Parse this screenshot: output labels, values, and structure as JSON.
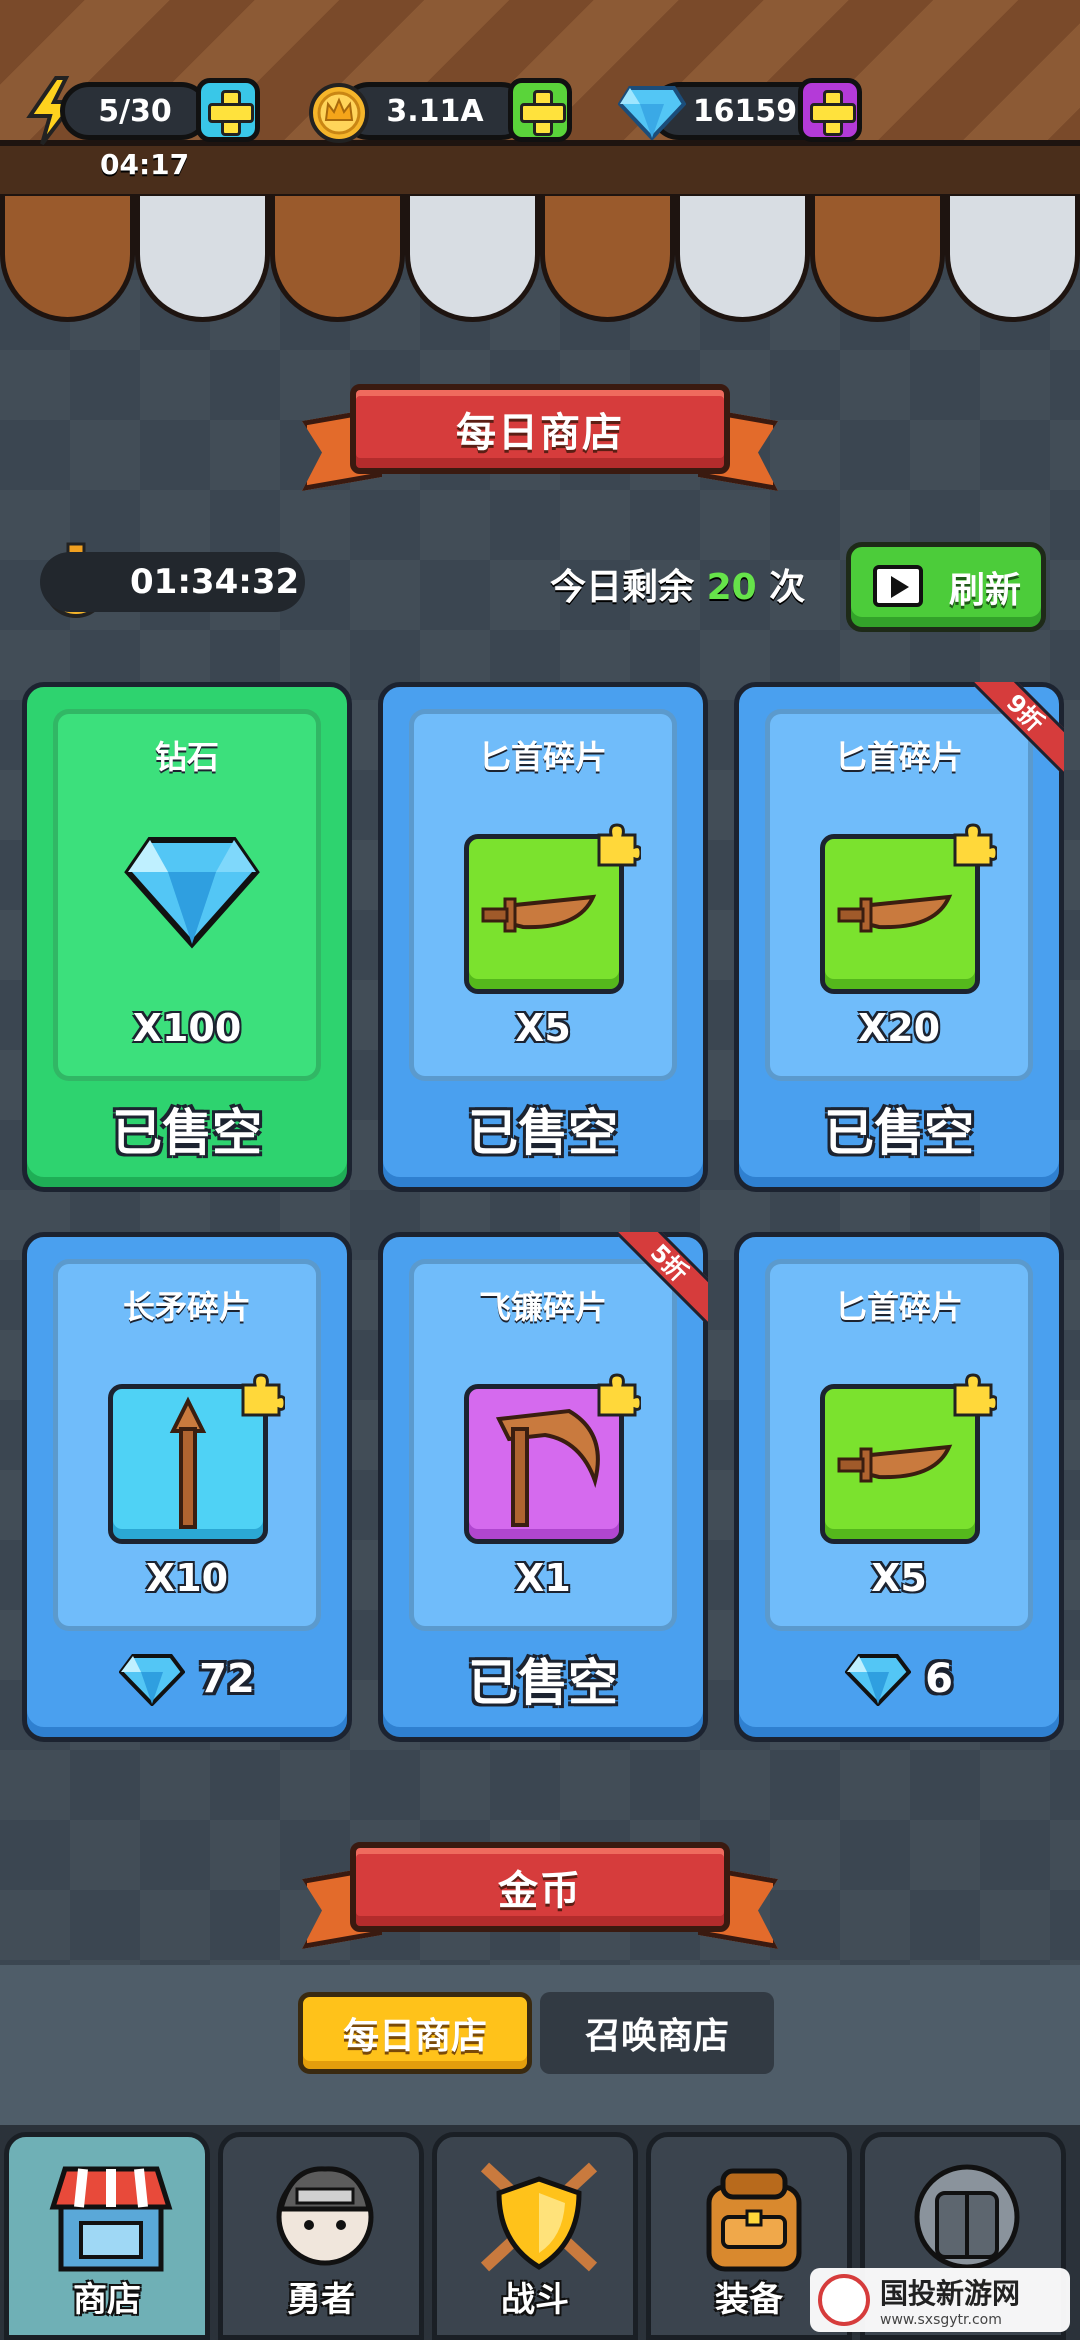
{
  "resources": {
    "energy": {
      "value": "5/30",
      "timer": "04:17",
      "icon": "lightning-icon"
    },
    "gold": {
      "value": "3.11A",
      "icon": "crown-coin-icon"
    },
    "gems": {
      "value": "16159",
      "icon": "diamond-icon"
    }
  },
  "daily_shop": {
    "title": "每日商店",
    "countdown": "01:34:32",
    "remaining_prefix": "今日剩余",
    "remaining_count": "20",
    "remaining_suffix": "次",
    "refresh_label": "刷新"
  },
  "items": [
    {
      "name": "钻石",
      "qty": "X100",
      "status": "已售空",
      "kind": "diamond",
      "color": "green"
    },
    {
      "name": "匕首碎片",
      "qty": "X5",
      "status": "已售空",
      "kind": "dagger",
      "color": "blue"
    },
    {
      "name": "匕首碎片",
      "qty": "X20",
      "status": "已售空",
      "kind": "dagger",
      "color": "blue",
      "discount": "9折"
    },
    {
      "name": "长矛碎片",
      "qty": "X10",
      "price": "72",
      "kind": "spear",
      "color": "blue"
    },
    {
      "name": "飞镰碎片",
      "qty": "X1",
      "status": "已售空",
      "kind": "sickle",
      "color": "blue",
      "discount": "5折"
    },
    {
      "name": "匕首碎片",
      "qty": "X5",
      "price": "6",
      "kind": "dagger",
      "color": "blue"
    }
  ],
  "gold_section": {
    "title": "金币"
  },
  "shop_tabs": {
    "daily": "每日商店",
    "summon": "召唤商店"
  },
  "nav": {
    "shop": "商店",
    "hero": "勇者",
    "battle": "战斗",
    "equipment": "装备"
  },
  "watermark": {
    "name": "国投新游网",
    "url": "www.sxsgytr.com"
  }
}
